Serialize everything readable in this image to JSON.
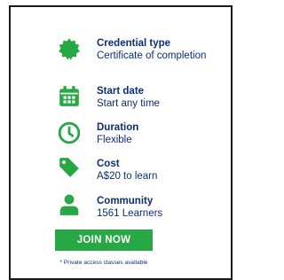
{
  "items": [
    {
      "label": "Credential type",
      "value": "Certificate of completion",
      "icon": "badge-icon"
    },
    {
      "label": "Start date",
      "value": "Start any time",
      "icon": "calendar-icon"
    },
    {
      "label": "Duration",
      "value": "Flexible",
      "icon": "clock-icon"
    },
    {
      "label": "Cost",
      "value": "A$20 to learn",
      "icon": "tag-icon"
    },
    {
      "label": "Community",
      "value": "1561 Learners",
      "icon": "person-icon"
    }
  ],
  "join_label": "JOIN NOW",
  "note": "* Private access classes available",
  "colors": {
    "accent": "#27a845",
    "text": "#0b2e78"
  }
}
